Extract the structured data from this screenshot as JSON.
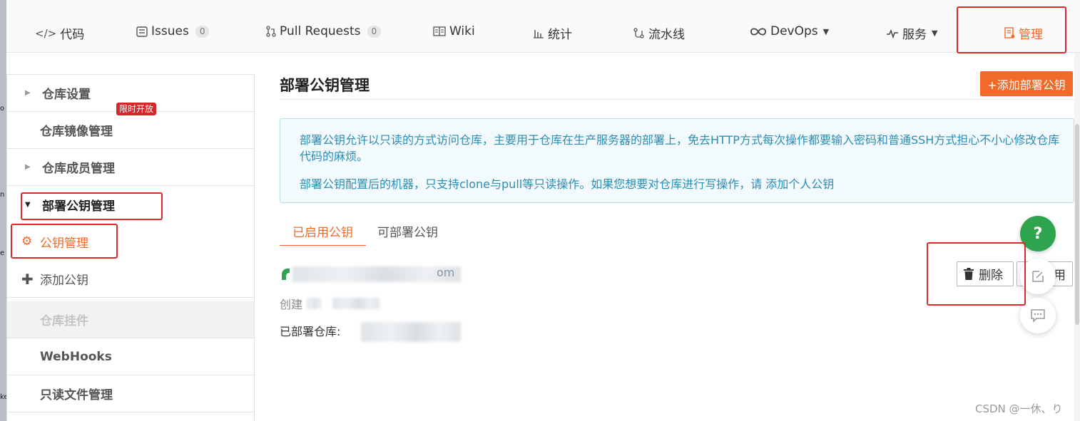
{
  "nav": {
    "items": [
      {
        "icon": "code-icon",
        "label": "代码"
      },
      {
        "icon": "issues-icon",
        "label": "Issues",
        "count": "0"
      },
      {
        "icon": "pull-request-icon",
        "label": "Pull Requests",
        "count": "0"
      },
      {
        "icon": "wiki-icon",
        "label": "Wiki"
      },
      {
        "icon": "stats-icon",
        "label": "统计"
      },
      {
        "icon": "pipeline-icon",
        "label": "流水线"
      },
      {
        "icon": "devops-icon",
        "label": "DevOps"
      },
      {
        "icon": "services-icon",
        "label": "服务"
      },
      {
        "icon": "manage-icon",
        "label": "管理"
      }
    ],
    "active": "管理",
    "accent_color": "#f26a2a"
  },
  "sidebar": {
    "items": [
      {
        "label": "仓库设置"
      },
      {
        "label": "仓库镜像管理",
        "badge": "限时开放"
      },
      {
        "label": "仓库成员管理"
      },
      {
        "label": "部署公钥管理"
      },
      {
        "label": "公钥管理"
      },
      {
        "label": "添加公钥"
      },
      {
        "label": "仓库挂件"
      },
      {
        "label": "WebHooks"
      },
      {
        "label": "只读文件管理"
      }
    ]
  },
  "main": {
    "title": "部署公钥管理",
    "add_button": "+添加部署公钥",
    "info": {
      "p1": "部署公钥允许以只读的方式访问仓库，主要用于仓库在生产服务器的部署上，免去HTTP方式每次操作都要输入密码和普通SSH方式担心不小心修改仓库代码的麻烦。",
      "p2": "部署公钥配置后的机器，只支持clone与pull等只读操作。如果您想要对仓库进行写操作，请 添加个人公钥"
    },
    "tabs": [
      "已启用公钥",
      "可部署公钥"
    ],
    "key": {
      "suffix": "om",
      "created_prefix": "创建",
      "deployed_label": "已部署仓库:"
    },
    "delete_button": "删除",
    "disable_button_partial": "用"
  },
  "fab": {
    "help": "?"
  },
  "watermark": "CSDN @一休、り",
  "left_strip_chars": [
    "o",
    "n",
    "e",
    "ke"
  ]
}
